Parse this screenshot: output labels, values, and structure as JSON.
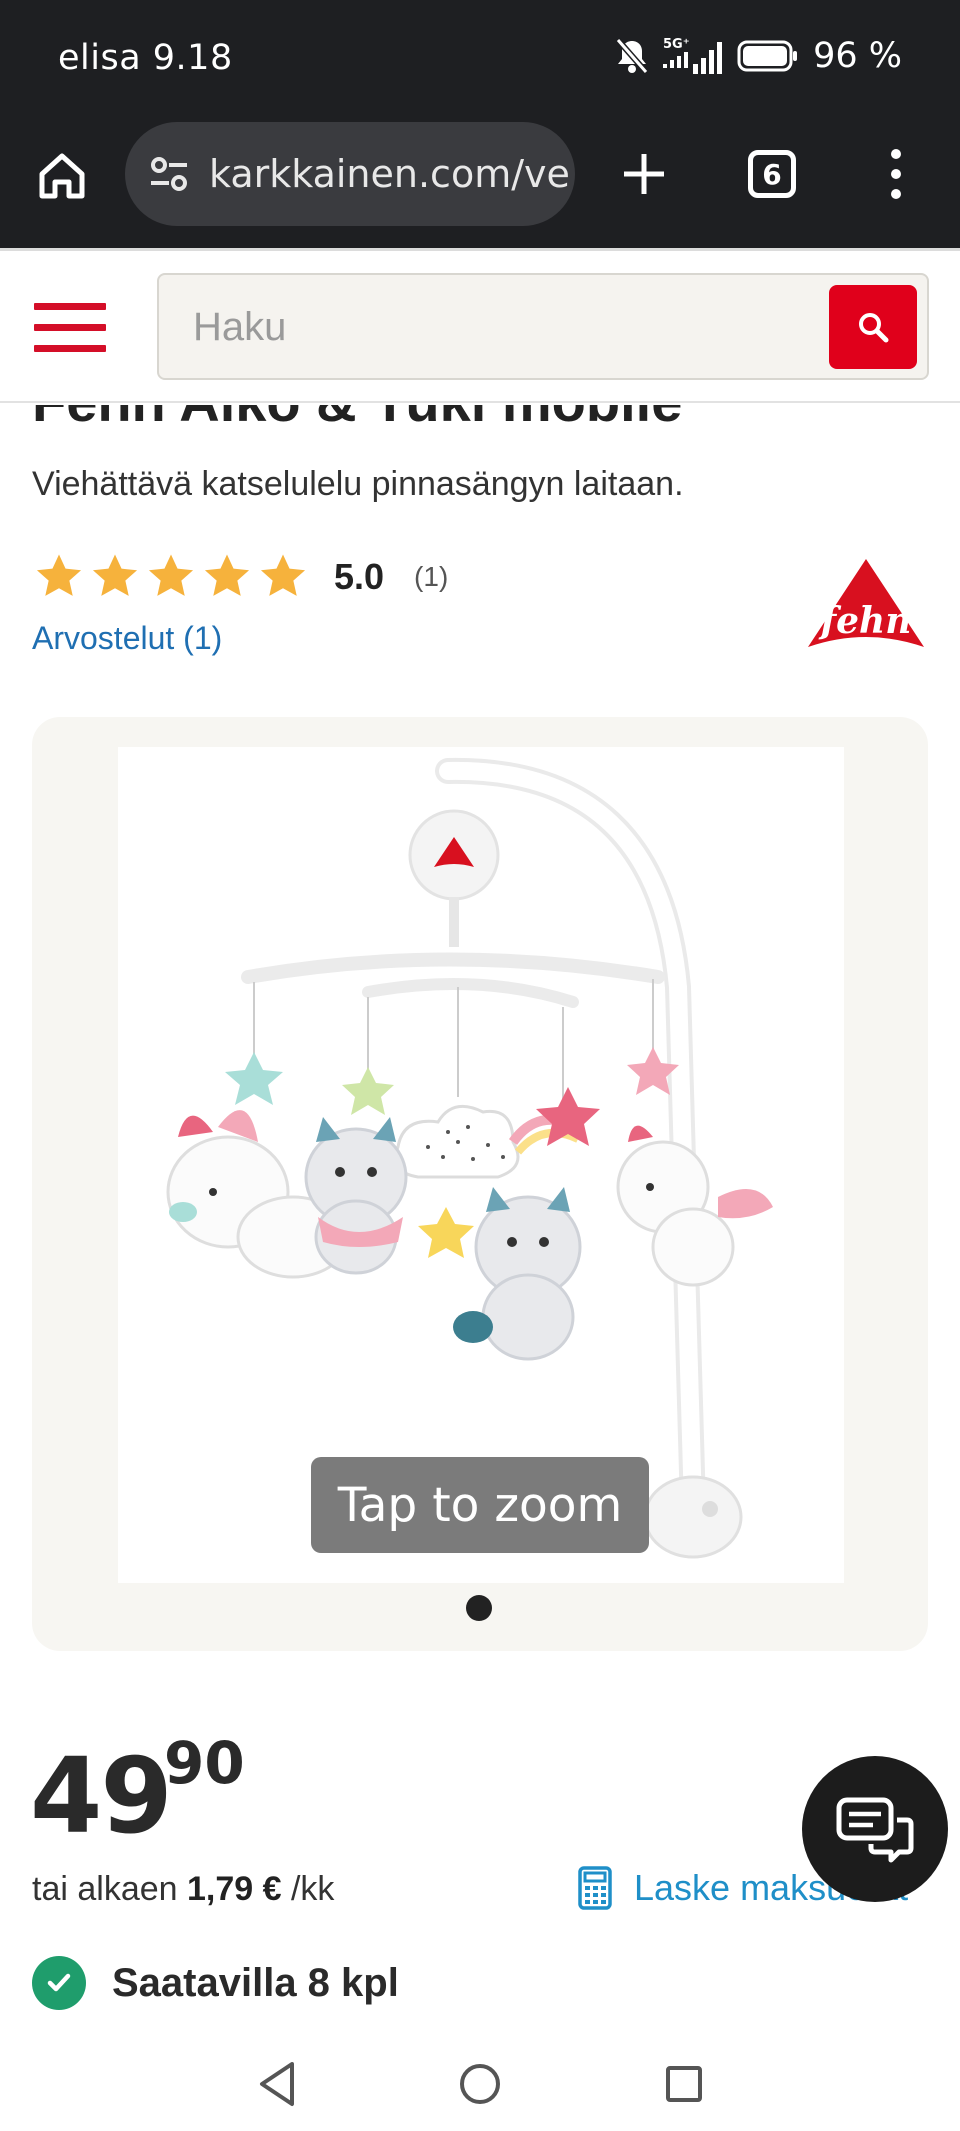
{
  "status_bar": {
    "carrier_time": "elisa 9.18",
    "network": "5G+",
    "battery": "96 %"
  },
  "browser": {
    "url": "karkkainen.com/ve",
    "tab_count": "6"
  },
  "header": {
    "search_placeholder": "Haku"
  },
  "product": {
    "title": "Fehn Aiko & Yuki mobile",
    "subtitle": "Viehättävä katselulelu pinnasängyn laitaan.",
    "rating_value": "5.0",
    "rating_count": "(1)",
    "reviews_link": "Arvostelut (1)",
    "brand": "fehn",
    "zoom_hint": "Tap to zoom",
    "price_int": "49",
    "price_dec": "90",
    "installment_prefix": "tai alkaen",
    "installment_amount": "1,79 €",
    "installment_suffix": "/kk",
    "calc_link": "Laske maksuerät",
    "availability": "Saatavilla 8 kpl"
  },
  "colors": {
    "brand_red": "#e0001b",
    "link_blue": "#1f6fb2",
    "star": "#f6b23c",
    "success": "#1f9d6c"
  }
}
